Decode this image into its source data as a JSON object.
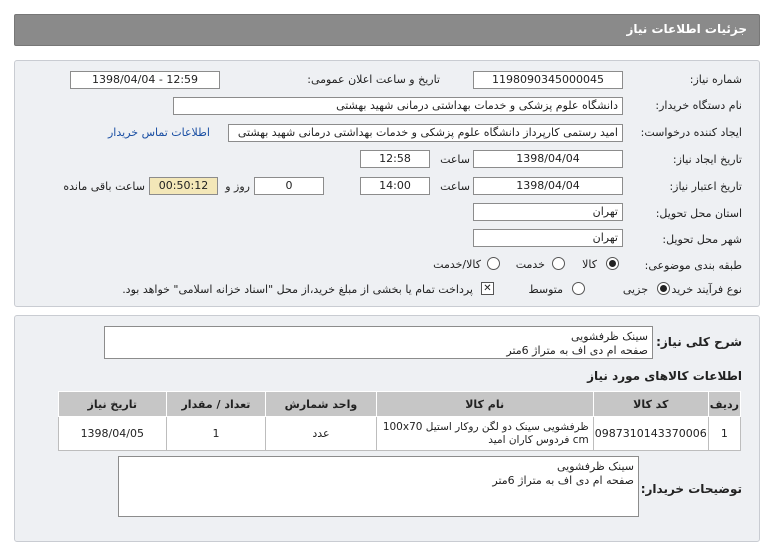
{
  "header": {
    "title": "جزئیات اطلاعات نیاز"
  },
  "form": {
    "need_number_label": "شماره نیاز:",
    "need_number": "1198090345000045",
    "announce_label": "تاریخ و ساعت اعلان عمومی:",
    "announce_value": "1398/04/04 - 12:59",
    "buyer_org_label": "نام دستگاه خریدار:",
    "buyer_org": "دانشگاه علوم پزشکی و خدمات بهداشتی درمانی شهید بهشتی",
    "requester_label": "ایجاد کننده درخواست:",
    "requester": "امید رستمی کارپرداز دانشگاه علوم پزشکی و خدمات بهداشتی درمانی شهید بهشتی",
    "contact_link": "اطلاعات تماس خریدار",
    "created_date_label": "تاریخ ایجاد نیاز:",
    "created_date": "1398/04/04",
    "time_label": "ساعت",
    "created_time": "12:58",
    "validity_label": "تاریخ اعتبار نیاز:",
    "validity_date": "1398/04/04",
    "validity_time": "14:00",
    "days_value": "0",
    "days_label": "روز و",
    "remaining_value": "00:50:12",
    "remaining_label": "ساعت باقی مانده",
    "province_label": "استان محل تحویل:",
    "province": "تهران",
    "city_label": "شهر محل تحویل:",
    "city": "تهران",
    "category_label": "طبقه بندی موضوعی:",
    "category_options": [
      "کالا",
      "خدمت",
      "کالا/خدمت"
    ],
    "purchase_type_label": "نوع فرآیند خرید :",
    "purchase_options": [
      "جزیی",
      "متوسط"
    ],
    "payment_note": "پرداخت تمام یا بخشی از مبلغ خرید،از محل \"اسناد خزانه اسلامی\" خواهد بود."
  },
  "summary": {
    "label": "شرح کلی نیاز:",
    "line1": "سینک ظرفشویی",
    "line2": "صفحه  ام دی اف به متراژ 6متر"
  },
  "items_section": {
    "title": "اطلاعات کالاهای مورد نیاز",
    "columns": [
      "ردیف",
      "کد کالا",
      "نام کالا",
      "واحد شمارش",
      "تعداد / مقدار",
      "تاریخ نیاز"
    ],
    "rows": [
      {
        "row": "1",
        "code": "0987310143370006",
        "name": "ظرفشویی سینک دو لگن روکار استیل 100x70 cm فردوس کاران امید",
        "unit": "عدد",
        "qty": "1",
        "date": "1398/04/05"
      }
    ]
  },
  "buyer_notes": {
    "label": "توضیحات خریدار:",
    "line1": "سینک ظرفشویی",
    "line2": "صفحه  ام دی اف به متراژ 6متر"
  }
}
